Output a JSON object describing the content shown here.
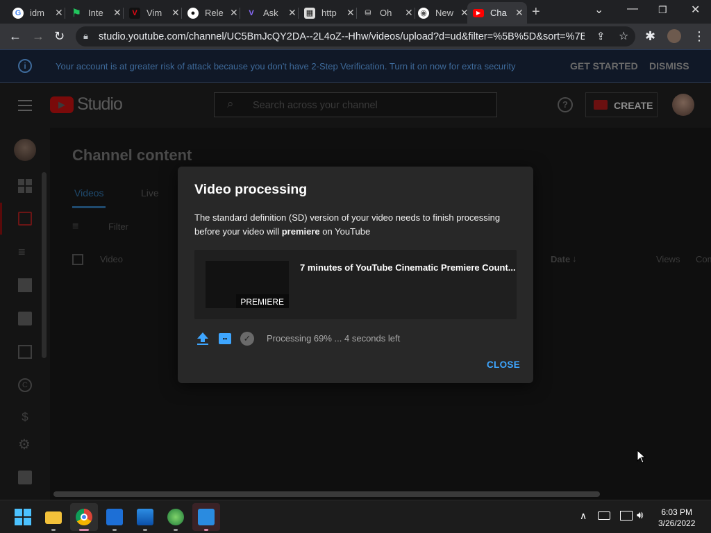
{
  "browser": {
    "tabs": [
      {
        "title": "idm",
        "icon": "google-icon"
      },
      {
        "title": "Inte",
        "icon": "flag-icon"
      },
      {
        "title": "Vim",
        "icon": "vimeo-icon"
      },
      {
        "title": "Rele",
        "icon": "github-icon"
      },
      {
        "title": "Ask",
        "icon": "ask-icon"
      },
      {
        "title": "http",
        "icon": "page-icon"
      },
      {
        "title": "Oh",
        "icon": "stack-icon"
      },
      {
        "title": "New",
        "icon": "chrome-icon"
      },
      {
        "title": "Cha",
        "icon": "youtube-icon"
      }
    ],
    "new_tab": "+",
    "url": "studio.youtube.com/channel/UC5BmJcQY2DA--2L4oZ--Hhw/videos/upload?d=ud&filter=%5B%5D&sort=%7B\"c..."
  },
  "banner": {
    "message": "Your account is at greater risk of attack because you don't have 2-Step Verification. Turn it on now for extra security",
    "get_started": "GET STARTED",
    "dismiss": "DISMISS"
  },
  "studio": {
    "logo_text": "Studio",
    "search_placeholder": "Search across your channel",
    "create_label": "CREATE"
  },
  "page": {
    "title": "Channel content",
    "tabs": [
      "Videos",
      "Live"
    ],
    "filter_placeholder": "Filter",
    "columns": {
      "video": "Video",
      "date": "Date",
      "views": "Views",
      "comments": "Com"
    }
  },
  "dialog": {
    "title": "Video processing",
    "body_pre": "The standard definition (SD) version of your video needs to finish processing before your video will ",
    "body_bold": "premiere",
    "body_post": " on YouTube",
    "video_title": "7 minutes of YouTube Cinematic Premiere Count...",
    "thumb_badge": "PREMIERE",
    "status": "Processing 69% ... 4 seconds left",
    "close": "CLOSE"
  },
  "taskbar": {
    "time": "6:03 PM",
    "date": "3/26/2022"
  },
  "colors": {
    "accent": "#3ea6ff",
    "youtube_red": "#ff0000",
    "dialog_bg": "#282828"
  }
}
